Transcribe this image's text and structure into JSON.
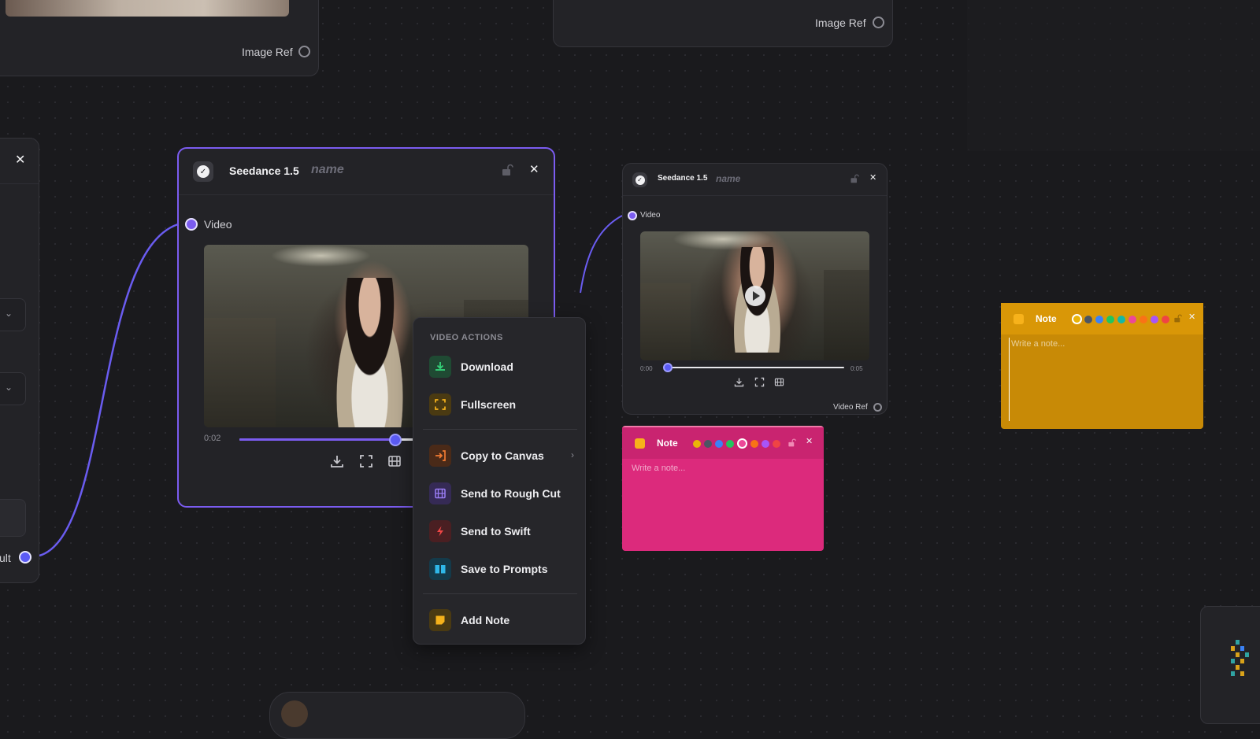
{
  "top_nodes": {
    "left_port_label": "Image Ref",
    "right_port_label": "Image Ref"
  },
  "left_partial": {
    "result_label": "ult"
  },
  "main_node": {
    "title": "Seedance 1.5",
    "name_placeholder": "name",
    "input_label": "Video",
    "time_current": "0:02",
    "progress": 0.55
  },
  "context_menu": {
    "heading": "VIDEO ACTIONS",
    "items": [
      {
        "label": "Download"
      },
      {
        "label": "Fullscreen"
      },
      {
        "label": "Copy to Canvas"
      },
      {
        "label": "Send to Rough Cut"
      },
      {
        "label": "Send to Swift"
      },
      {
        "label": "Save to Prompts"
      },
      {
        "label": "Add Note"
      }
    ]
  },
  "second_node": {
    "title": "Seedance 1.5",
    "name_placeholder": "name",
    "input_label": "Video",
    "time_start": "0:00",
    "time_end": "0:05",
    "progress": 0.0,
    "output_label": "Video Ref"
  },
  "note_pink": {
    "title": "Note",
    "placeholder": "Write a note...",
    "color": "#dc2a7c"
  },
  "note_yellow": {
    "title": "Note",
    "placeholder": "Write a note...",
    "color": "#c88a06"
  },
  "colors": {
    "accent": "#7b5cf0",
    "canvas": "#1a1a1d",
    "node": "#232327",
    "swatches": [
      "#eab308",
      "#4b5563",
      "#3b82f6",
      "#22c55e",
      "#14b8a6",
      "#ec4899",
      "#f97316",
      "#a855f7",
      "#ef4444"
    ]
  }
}
